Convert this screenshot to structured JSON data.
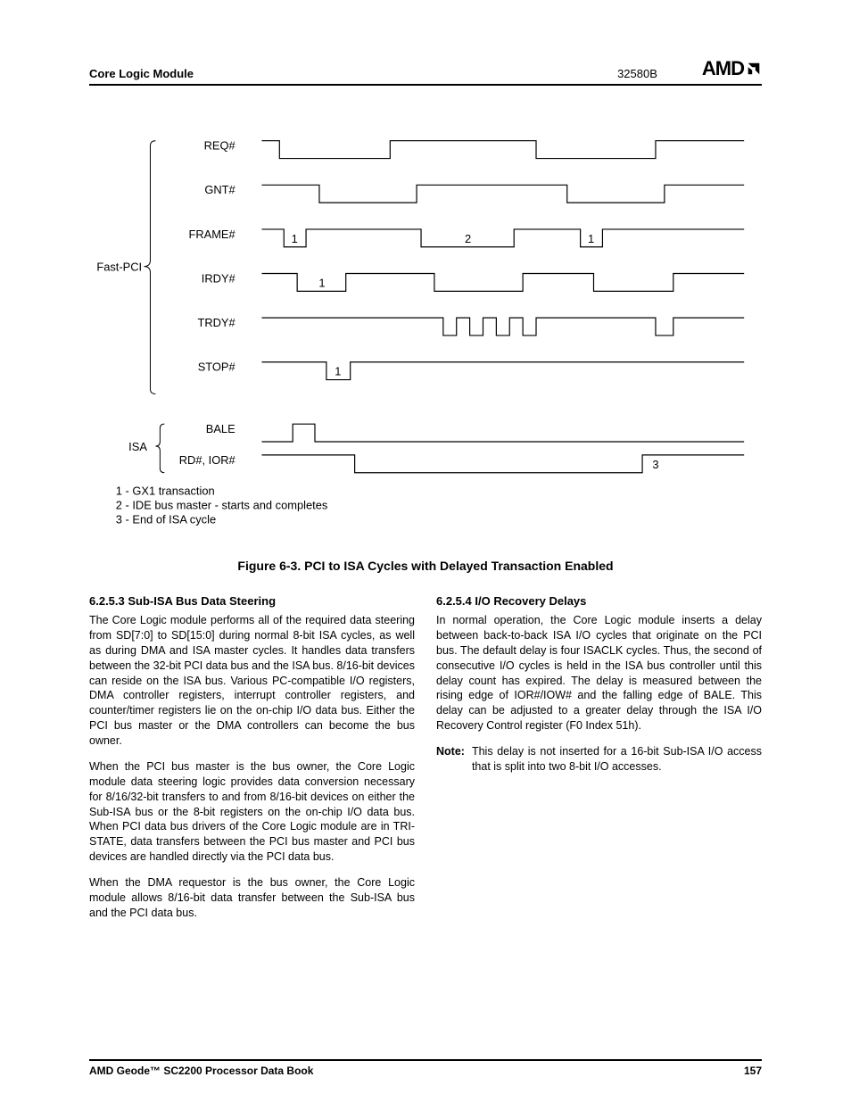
{
  "header": {
    "left": "Core Logic Module",
    "doc_number": "32580B",
    "logo_text": "AMD"
  },
  "figure": {
    "title": "Figure 6-3.  PCI to ISA Cycles with Delayed Transaction Enabled",
    "group1": "Fast-PCI",
    "group2": "ISA",
    "signals": {
      "req": "REQ#",
      "gnt": "GNT#",
      "frame": "FRAME#",
      "irdy": "IRDY#",
      "trdy": "TRDY#",
      "stop": "STOP#",
      "bale": "BALE",
      "rd_ior": "RD#, IOR#"
    },
    "labels": {
      "l1": "1",
      "l2": "2",
      "l3": "3"
    },
    "legend": {
      "line1": "1 - GX1 transaction",
      "line2": "2 - IDE bus master - starts and completes",
      "line3": "3 - End of ISA cycle"
    }
  },
  "left_col": {
    "head": "6.2.5.3    Sub-ISA Bus Data Steering",
    "p1": "The Core Logic module performs all of the required data steering from SD[7:0] to SD[15:0] during normal 8-bit ISA cycles, as well as during DMA and ISA master cycles. It handles data transfers between the 32-bit PCI data bus and the ISA bus. 8/16-bit devices can reside on the ISA bus. Various PC-compatible I/O registers, DMA controller registers, interrupt controller registers, and counter/timer registers lie on the on-chip I/O data bus. Either the PCI bus master or the DMA controllers can become the bus owner.",
    "p2": "When the PCI bus master is the bus owner, the Core Logic module data steering logic provides data conversion necessary for 8/16/32-bit transfers to and from 8/16-bit devices on either the Sub-ISA bus or the 8-bit registers on the on-chip I/O data bus. When PCI data bus drivers of the Core Logic module are in TRI-STATE, data transfers between the PCI bus master and PCI bus devices are handled directly via the PCI data bus.",
    "p3": "When the DMA requestor is the bus owner, the Core Logic module allows 8/16-bit data transfer between the Sub-ISA bus and the PCI data bus."
  },
  "right_col": {
    "head": "6.2.5.4    I/O Recovery Delays",
    "p1": "In normal operation, the Core Logic module inserts a delay between back-to-back ISA I/O cycles that originate on the PCI bus. The default delay is four ISACLK cycles. Thus, the second of consecutive I/O cycles is held in the ISA bus controller until this delay count has expired. The delay is measured between the rising edge of IOR#/IOW# and the falling edge of BALE. This delay can be adjusted to a greater delay through the ISA I/O Recovery Control register (F0 Index 51h).",
    "note_label": "Note:",
    "note_text": "This delay is not inserted for a 16-bit Sub-ISA I/O access that is split into two 8-bit I/O accesses."
  },
  "footer": {
    "left": "AMD Geode™ SC2200  Processor Data Book",
    "right": "157"
  }
}
